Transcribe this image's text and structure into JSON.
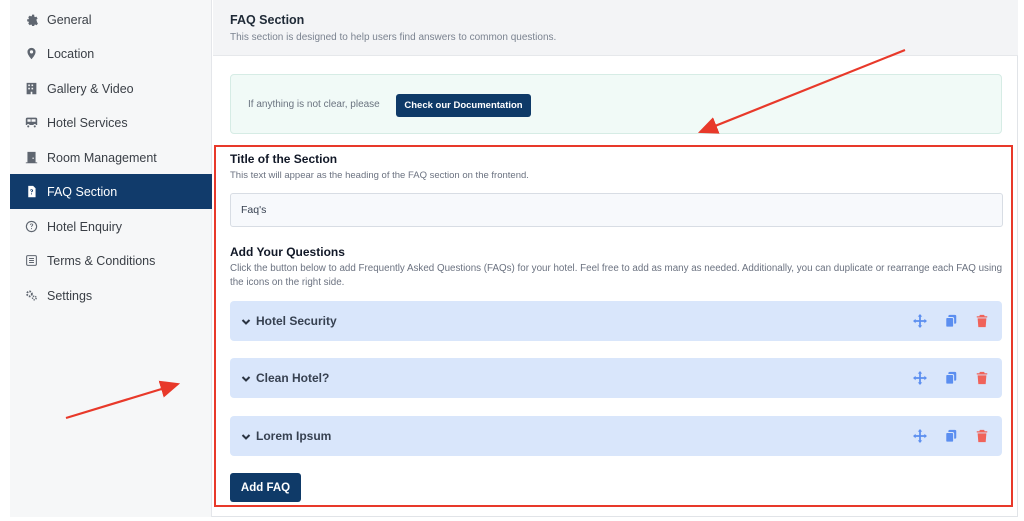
{
  "sidebar": {
    "items": [
      {
        "label": "General",
        "icon": "gear-icon"
      },
      {
        "label": "Location",
        "icon": "map-pin-icon"
      },
      {
        "label": "Gallery & Video",
        "icon": "building-icon"
      },
      {
        "label": "Hotel Services",
        "icon": "bus-icon"
      },
      {
        "label": "Room Management",
        "icon": "door-icon"
      },
      {
        "label": "FAQ Section",
        "icon": "faq-icon",
        "active": true
      },
      {
        "label": "Hotel Enquiry",
        "icon": "question-circle-icon"
      },
      {
        "label": "Terms & Conditions",
        "icon": "list-icon"
      },
      {
        "label": "Settings",
        "icon": "cogs-icon"
      }
    ]
  },
  "header": {
    "title": "FAQ Section",
    "subtitle": "This section is designed to help users find answers to common questions."
  },
  "notice": {
    "text": "If anything is not clear, please",
    "button_label": "Check our Documentation"
  },
  "section_title": {
    "label": "Title of the Section",
    "description": "This text will appear as the heading of the FAQ section on the frontend.",
    "value": "Faq's"
  },
  "questions": {
    "label": "Add Your Questions",
    "description": "Click the button below to add Frequently Asked Questions (FAQs) for your hotel. Feel free to add as many as needed. Additionally, you can duplicate or rearrange each FAQ using the icons on the right side.",
    "items": [
      {
        "title": "Hotel Security"
      },
      {
        "title": "Clean Hotel?"
      },
      {
        "title": "Lorem Ipsum"
      }
    ],
    "add_button_label": "Add FAQ"
  },
  "colors": {
    "accent": "#113b6b",
    "faq_row_bg": "#d9e6fb",
    "move_icon": "#5b8ef0",
    "copy_icon": "#5b8ef0",
    "delete_icon": "#f0635a",
    "highlight": "#e8392a"
  }
}
